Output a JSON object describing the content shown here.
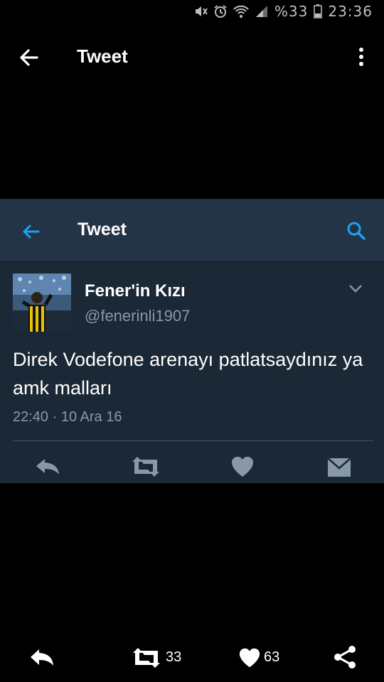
{
  "status_bar": {
    "battery_percent": "%33",
    "time": "23:36"
  },
  "outer_header": {
    "title": "Tweet"
  },
  "embedded": {
    "header_title": "Tweet",
    "author": {
      "name": "Fener'in Kızı",
      "handle": "@fenerinli1907"
    },
    "tweet": {
      "text": "Direk Vodefone arenayı patlatsaydınız ya amk malları",
      "time": "22:40",
      "separator": "·",
      "date": "10 Ara 16"
    }
  },
  "bottom_actions": {
    "retweet_count": "33",
    "like_count": "63"
  },
  "colors": {
    "background": "#000000",
    "embed_bg": "#1b2836",
    "embed_header_bg": "#243447",
    "accent_blue": "#1da1f2",
    "muted_text": "#8899a6",
    "icon_gray": "#8899a6"
  },
  "icons": [
    "mute-icon",
    "alarm-icon",
    "wifi-icon",
    "signal-icon",
    "battery-icon",
    "back-arrow-icon",
    "more-vertical-icon",
    "search-icon",
    "chevron-down-icon",
    "reply-icon",
    "retweet-icon",
    "heart-icon",
    "message-icon",
    "share-icon"
  ]
}
